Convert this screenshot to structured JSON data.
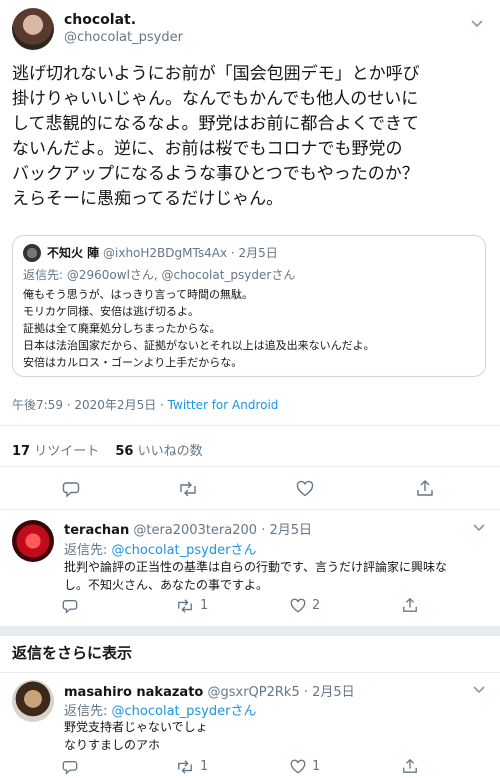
{
  "main_tweet": {
    "author_name": "chocolat.",
    "author_handle": "@chocolat_psyder",
    "text_lines": [
      "逃げ切れないようにお前が「国会包囲デモ」とか呼び",
      "掛けりゃいいじゃん。なんでもかんでも他人のせいに",
      "して悲観的になるなよ。野党はお前に都合よくできて",
      "ないんだよ。逆に、お前は桜でもコロナでも野党の",
      "バックアップになるような事ひとつでもやったのか？",
      "えらそーに愚痴ってるだけじゃん。"
    ],
    "timestamp": "午後7:59 · 2020年2月5日",
    "source": "Twitter for Android",
    "retweets_count": "17",
    "retweets_label": "リツイート",
    "likes_count": "56",
    "likes_label": "いいねの数"
  },
  "quoted_tweet": {
    "author_name": "不知火 陣",
    "author_handle": "@ixhoH2BDgMTs4Ax",
    "date": "· 2月5日",
    "reply_to_prefix": "返信先:",
    "reply_to_1": "@2960owlさん",
    "reply_to_2": "@chocolat_psyderさん",
    "text_lines": [
      "俺もそう思うが、はっきり言って時間の無駄。",
      "モリカケ同様、安倍は逃げ切るよ。",
      "証拠は全て廃棄処分しちまったからな。",
      "日本は法治国家だから、証拠がないとそれ以上は追及出来ないんだよ。",
      "安倍はカルロス・ゴーンより上手だからな。"
    ]
  },
  "replies": [
    {
      "author_name": "terachan",
      "author_handle": "@tera2003tera200",
      "date": "· 2月5日",
      "reply_to_prefix": "返信先:",
      "reply_to": "@chocolat_psyderさん",
      "text_lines": [
        "批判や論評の正当性の基準は自らの行動です、言うだけ評論家に興味な",
        "し。不知火さん、あなたの事ですよ。"
      ],
      "retweet_count": "1",
      "like_count": "2"
    },
    {
      "author_name": "masahiro nakazato",
      "author_handle": "@gsxrQP2Rk5",
      "date": "· 2月5日",
      "reply_to_prefix": "返信先:",
      "reply_to": "@chocolat_psyderさん",
      "text_lines": [
        "野党支持者じゃないでしょ",
        "なりすましのアホ"
      ],
      "retweet_count": "1",
      "like_count": "1"
    }
  ],
  "show_more_label": "返信をさらに表示",
  "colors": {
    "link": "#1b95e0",
    "muted": "#657786",
    "text": "#14171a",
    "divider": "#e6ecf0"
  }
}
